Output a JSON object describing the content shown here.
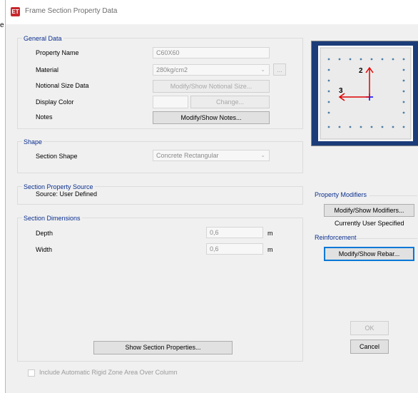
{
  "window": {
    "title": "Frame Section Property Data",
    "app_icon": "ET"
  },
  "edge_mark": "e",
  "general": {
    "title": "General Data",
    "property_name_label": "Property Name",
    "property_name_value": "C60X60",
    "material_label": "Material",
    "material_value": "280kg/cm2",
    "material_more": "...",
    "notional_label": "Notional Size Data",
    "notional_button": "Modify/Show Notional Size...",
    "display_color_label": "Display Color",
    "change_button": "Change...",
    "notes_label": "Notes",
    "notes_button": "Modify/Show Notes..."
  },
  "shape": {
    "title": "Shape",
    "section_shape_label": "Section Shape",
    "section_shape_value": "Concrete Rectangular"
  },
  "source": {
    "title": "Section Property Source",
    "source_text": "Source:  User Defined"
  },
  "dimensions": {
    "title": "Section Dimensions",
    "depth_label": "Depth",
    "depth_value": "0,6",
    "depth_unit": "m",
    "width_label": "Width",
    "width_value": "0,6",
    "width_unit": "m",
    "show_props_button": "Show Section Properties..."
  },
  "preview": {
    "axis2": "2",
    "axis3": "3"
  },
  "modifiers": {
    "title": "Property Modifiers",
    "button": "Modify/Show Modifiers...",
    "status": "Currently User Specified"
  },
  "reinforcement": {
    "title": "Reinforcement",
    "button": "Modify/Show Rebar..."
  },
  "footer": {
    "ok": "OK",
    "cancel": "Cancel",
    "rigid_zone_label": "Include Automatic Rigid Zone Area Over Column"
  }
}
